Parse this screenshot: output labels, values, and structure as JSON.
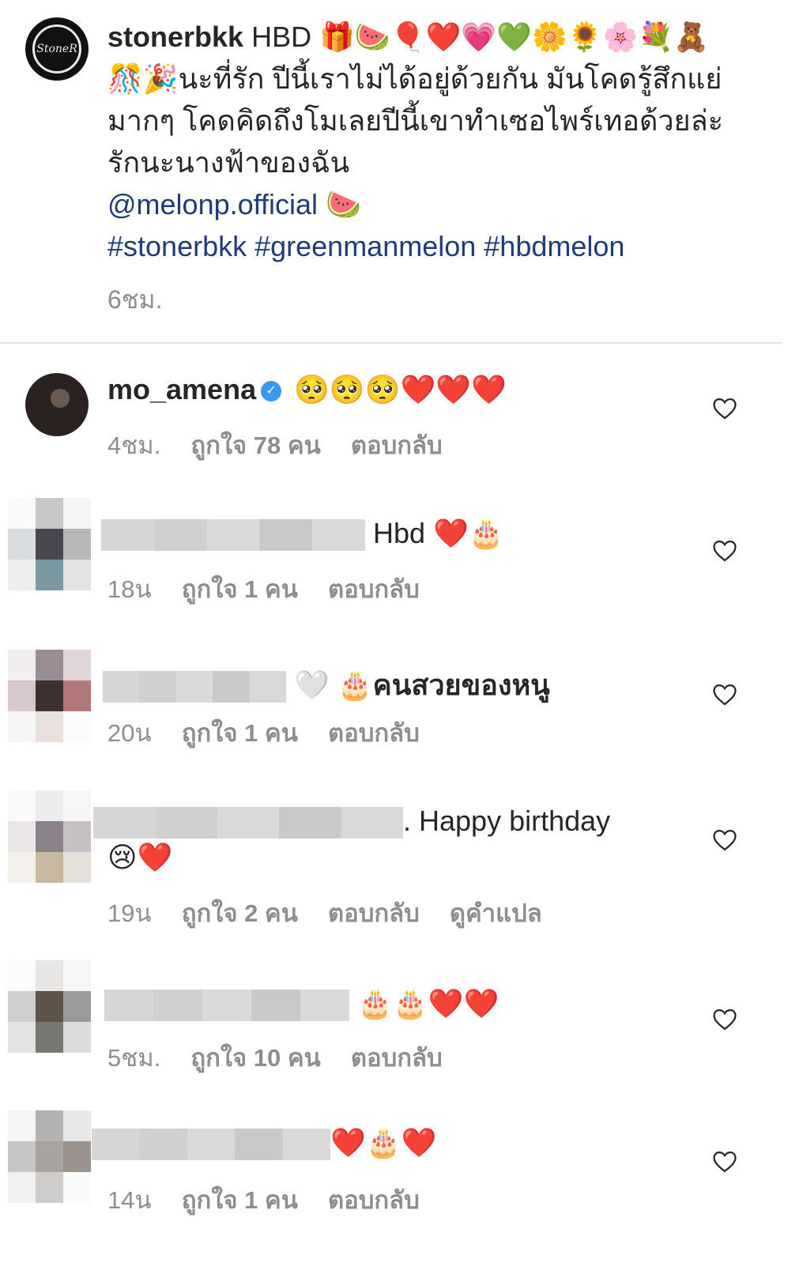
{
  "post": {
    "username": "stonerbkk",
    "avatar_text": "StoneR",
    "caption_part1": " HBD 🎁🍉🎈❤️💗💚🌼🌻🌸💐🧸🎊🎉นะที่รัก ปีนี้เราไม่ได้อยู่ด้วยกัน มันโคดรู้สึกแย่มากๆ โคดคิดถึงโมเลยปีนี้เขาทำเซอไพร์เทอด้วยล่ะ รักนะนางฟ้าของฉัน",
    "mention": "@melonp.official",
    "mention_emoji": " 🍉",
    "hashtags": "#stonerbkk #greenmanmelon #hbdmelon",
    "time": "6ชม."
  },
  "comments": [
    {
      "username": "mo_amena",
      "verified_icon": "✓",
      "text": " 🥺🥺🥺❤️❤️❤️",
      "time": "4ชม.",
      "likes": "ถูกใจ 78 คน",
      "reply": "ตอบกลับ"
    },
    {
      "text": "Hbd ❤️🎂",
      "time": "18น",
      "likes": "ถูกใจ 1 คน",
      "reply": "ตอบกลับ"
    },
    {
      "text": "🤍 🎂คนสวยของหนู",
      "time": "20น",
      "likes": "ถูกใจ 1 คน",
      "reply": "ตอบกลับ"
    },
    {
      "text": ". Happy birthday",
      "text2": "😢❤️",
      "time": "19น",
      "likes": "ถูกใจ 2 คน",
      "reply": "ตอบกลับ",
      "translate": "ดูคำแปล"
    },
    {
      "text": "🎂🎂❤️❤️",
      "time": "5ชม.",
      "likes": "ถูกใจ 10 คน",
      "reply": "ตอบกลับ"
    },
    {
      "text": "❤️🎂❤️",
      "time": "14น",
      "likes": "ถูกใจ 1 คน",
      "reply": "ตอบกลับ"
    }
  ],
  "colors": {
    "link": "#1e3c78",
    "muted": "#8e8e8e",
    "verified": "#3897f0"
  },
  "icons": {
    "like": "heart-outline-icon"
  }
}
